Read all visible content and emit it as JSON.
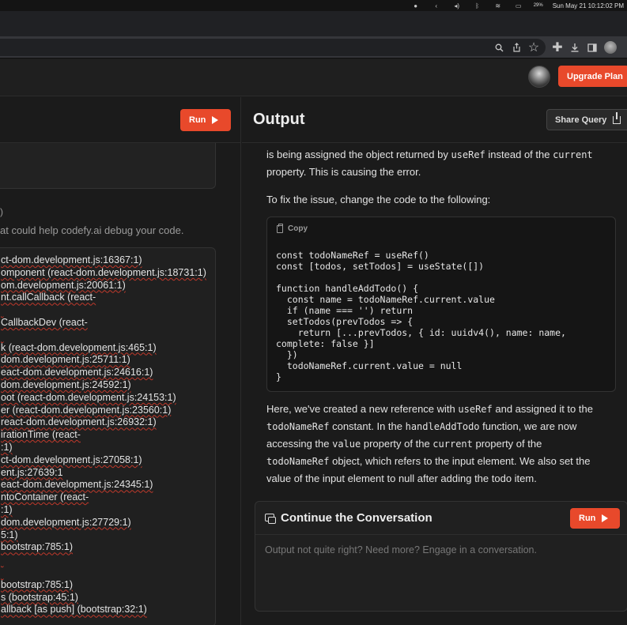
{
  "menubar": {
    "battery": "29%",
    "datetime": "Sun May 21  10:12:02 PM"
  },
  "header": {
    "upgrade_label": "Upgrade Plan"
  },
  "left": {
    "run_label": "Run",
    "hint_mark": ")",
    "hint_text": "at could help codefy.ai debug your code.",
    "stack_lines": [
      "ct-dom.development.js:16367:1)",
      "omponent (react-dom.development.js:18731:1)",
      "om.development.js:20061:1)",
      "nt.callCallback (react-",
      "",
      "CallbackDev (react-",
      "",
      "k (react-dom.development.js:465:1)",
      "dom.development.js:25711:1)",
      "eact-dom.development.js:24616:1)",
      "dom.development.js:24592:1)",
      "oot (react-dom.development.js:24153:1)",
      "er (react-dom.development.js:23560:1)",
      "react-dom.development.js:26932:1)",
      "irationTime (react-",
      ":1)",
      "ct-dom.development.js:27058:1)",
      "ent.js:27639:1",
      "eact-dom.development.js:24345:1)",
      "ntoContainer (react-",
      ":1)",
      "dom.development.js:27729:1)",
      "5:1)",
      "bootstrap:785:1)",
      "",
      "",
      "bootstrap:785:1)",
      "s (bootstrap:45:1)",
      "allback [as push] (bootstrap:32:1)"
    ]
  },
  "output": {
    "title": "Output",
    "share_label": "Share Query",
    "p1_a": "is being assigned the object returned by ",
    "p1_code1": "useRef",
    "p1_b": " instead of the ",
    "p1_code2": "current",
    "p1_c": " property. This is causing the error.",
    "p2": "To fix the issue, change the code to the following:",
    "copy_label": "Copy",
    "code_lines": [
      "const todoNameRef = useRef()",
      "const [todos, setTodos] = useState([])",
      "",
      "function handleAddTodo() {",
      "  const name = todoNameRef.current.value",
      "  if (name === '') return",
      "  setTodos(prevTodos => {",
      "    return [...prevTodos, { id: uuidv4(), name: name,",
      "complete: false }]",
      "  })",
      "  todoNameRef.current.value = null",
      "}"
    ],
    "p3_a": "Here, we've created a new reference with ",
    "p3_code1": "useRef",
    "p3_b": " and assigned it to the ",
    "p3_code2": "todoNameRef",
    "p3_c": " constant. In the ",
    "p3_code3": "handleAddTodo",
    "p3_d": " function, we are now accessing the ",
    "p3_code4": "value",
    "p3_e": " property of the ",
    "p3_code5": "current",
    "p3_f": " property of the ",
    "p3_code6": "todoNameRef",
    "p3_g": " object, which refers to the input element. We also set the value of the input element to null after adding the todo item."
  },
  "conversation": {
    "title": "Continue the Conversation",
    "run_label": "Run",
    "placeholder": "Output not quite right? Need more? Engage in a conversation."
  },
  "colors": {
    "accent": "#e8492b",
    "background": "#1b1b1b"
  }
}
